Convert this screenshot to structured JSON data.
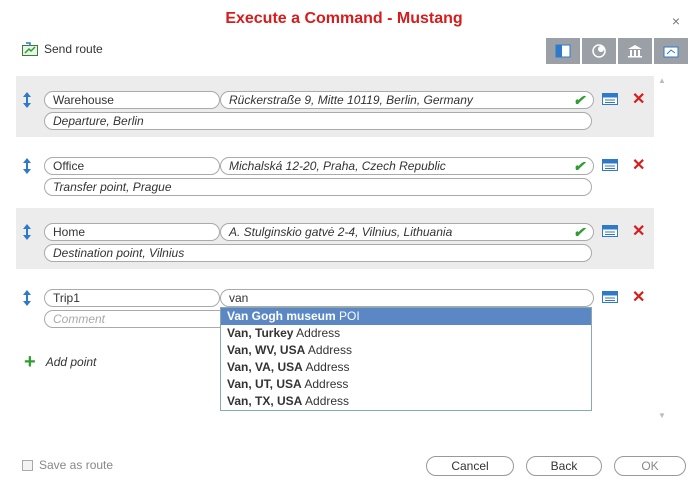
{
  "window": {
    "title": "Execute a Command - Mustang",
    "close_glyph": "×"
  },
  "send_route": {
    "label": "Send route",
    "icon": "send-route-icon"
  },
  "toolbar": {
    "buttons": [
      {
        "name": "split-view-icon"
      },
      {
        "name": "poi-icon"
      },
      {
        "name": "landmark-icon"
      },
      {
        "name": "export-icon"
      }
    ]
  },
  "points": [
    {
      "name": "Warehouse",
      "address": "Rückerstraße 9, Mitte 10119, Berlin, Germany",
      "comment": "Departure, Berlin",
      "valid": true
    },
    {
      "name": "Office",
      "address": "Michalská 12-20, Praha, Czech Republic",
      "comment": "Transfer point, Prague",
      "valid": true
    },
    {
      "name": "Home",
      "address": "A. Stulginskio gatvė 2-4, Vilnius, Lithuania",
      "comment": "Destination point, Vilnius",
      "valid": true
    },
    {
      "name": "Trip1",
      "address": "van",
      "comment": "Comment",
      "valid": false
    }
  ],
  "icons": {
    "check": "✔",
    "delete": "✕",
    "plus": "+"
  },
  "add_point": {
    "label": "Add point"
  },
  "suggestions": [
    {
      "main": "Van Gogh museum",
      "type": "POI"
    },
    {
      "main": "Van, Turkey",
      "type": "Address"
    },
    {
      "main": "Van, WV, USA",
      "type": "Address"
    },
    {
      "main": "Van, VA, USA",
      "type": "Address"
    },
    {
      "main": "Van, UT, USA",
      "type": "Address"
    },
    {
      "main": "Van, TX, USA",
      "type": "Address"
    }
  ],
  "footer": {
    "save_as_route": "Save as route",
    "cancel": "Cancel",
    "back": "Back",
    "ok": "OK"
  },
  "colors": {
    "accent": "#d61c1c",
    "check": "#2e9e2e",
    "selected": "#5b87c5",
    "toolbar": "#9aa0a6"
  }
}
